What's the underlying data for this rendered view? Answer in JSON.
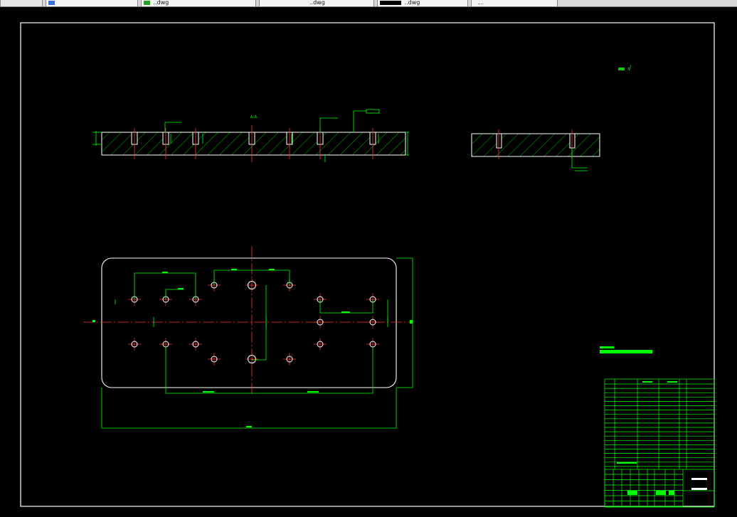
{
  "tabs": [
    {
      "label": "",
      "icon": "document-icon",
      "active": false
    },
    {
      "label": "..dwg",
      "icon": "drawing-file-icon",
      "active": false
    },
    {
      "label": "..dwg",
      "icon": "drawing-file-icon",
      "active": false
    },
    {
      "label": "..dwg",
      "icon": "drawing-file-icon",
      "active": true
    },
    {
      "label": "...",
      "icon": "drawing-file-icon",
      "active": false
    }
  ],
  "drawing": {
    "colors": {
      "background": "#000000",
      "border": "#ffffff",
      "dimension": "#00ff00",
      "outline": "#ffffff",
      "centerline": "#ff0000",
      "hatch": "#00cc00"
    },
    "roughness_mark": "√",
    "view_marker": "A-A"
  }
}
